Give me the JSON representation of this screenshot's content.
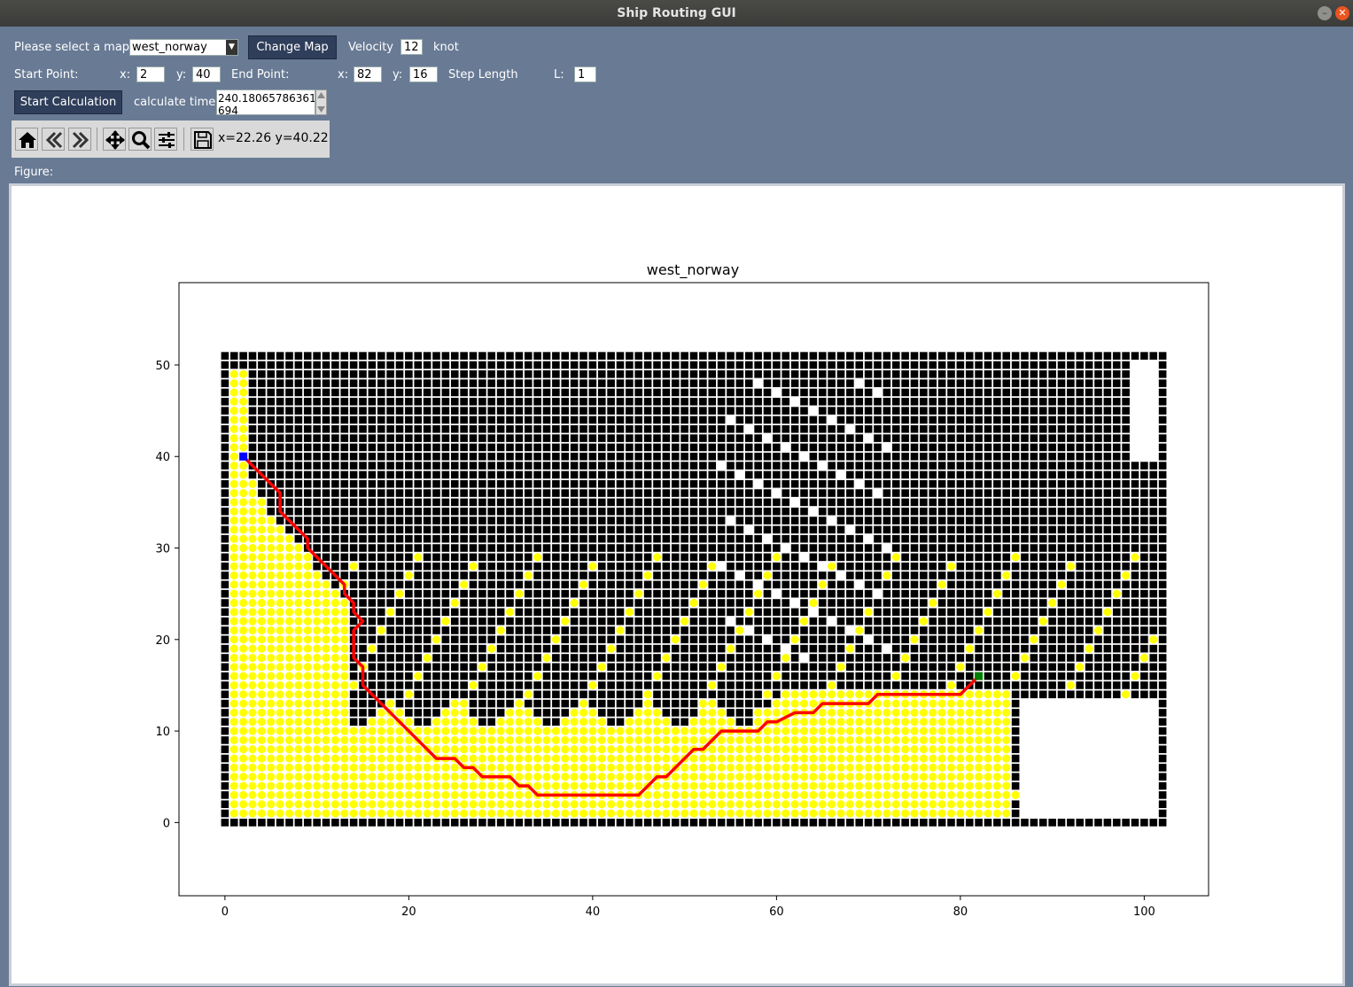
{
  "window": {
    "title": "Ship Routing GUI"
  },
  "controls": {
    "map_label": "Please select a map",
    "map_value": "west_norway",
    "change_map": "Change Map",
    "velocity_label": "Velocity",
    "velocity_value": "12",
    "velocity_unit": "knot",
    "start_label": "Start Point:",
    "start_x_label": "x:",
    "start_x": "2",
    "start_y_label": "y:",
    "start_y": "40",
    "end_label": "End Point:",
    "end_x_label": "x:",
    "end_x": "82",
    "end_y_label": "y:",
    "end_y": "16",
    "step_label": "Step Length",
    "l_label": "L:",
    "l_value": "1",
    "start_calc": "Start Calculation",
    "calc_time_label": "calculate time",
    "calc_time_line1": "240.18065786361",
    "calc_time_line2": "694"
  },
  "toolbar": {
    "coords": "x=22.26 y=40.22",
    "icons": [
      "home-icon",
      "back-icon",
      "forward-icon",
      "pan-icon",
      "zoom-icon",
      "configure-icon",
      "save-icon"
    ]
  },
  "figure_label": "Figure:",
  "chart_data": {
    "type": "scatter",
    "title": "west_norway",
    "xlim": [
      -5,
      107
    ],
    "ylim": [
      -8,
      59
    ],
    "xticks": [
      0,
      20,
      40,
      60,
      80,
      100
    ],
    "yticks": [
      0,
      10,
      20,
      30,
      40,
      50
    ],
    "grid": false,
    "colors": {
      "land": "#000000",
      "water": "#ffff00",
      "route": "#ff0000",
      "start": "#0000ff",
      "end": "#008000"
    },
    "start": [
      2,
      40
    ],
    "end": [
      82,
      16
    ],
    "route": [
      [
        2,
        40
      ],
      [
        6,
        36
      ],
      [
        6,
        34
      ],
      [
        8,
        32
      ],
      [
        9,
        31
      ],
      [
        9,
        30
      ],
      [
        13,
        26
      ],
      [
        13,
        25
      ],
      [
        14,
        24
      ],
      [
        14,
        23
      ],
      [
        15,
        22
      ],
      [
        14,
        21
      ],
      [
        14,
        18
      ],
      [
        15,
        17
      ],
      [
        15,
        15
      ],
      [
        16,
        14
      ],
      [
        23,
        7
      ],
      [
        25,
        7
      ],
      [
        26,
        6
      ],
      [
        27,
        6
      ],
      [
        28,
        5
      ],
      [
        31,
        5
      ],
      [
        32,
        4
      ],
      [
        33,
        4
      ],
      [
        34,
        3
      ],
      [
        45,
        3
      ],
      [
        47,
        5
      ],
      [
        48,
        5
      ],
      [
        51,
        8
      ],
      [
        52,
        8
      ],
      [
        54,
        10
      ],
      [
        58,
        10
      ],
      [
        59,
        11
      ],
      [
        60,
        11
      ],
      [
        62,
        12
      ],
      [
        64,
        12
      ],
      [
        65,
        13
      ],
      [
        70,
        13
      ],
      [
        71,
        14
      ],
      [
        80,
        14
      ],
      [
        82,
        16
      ]
    ]
  }
}
